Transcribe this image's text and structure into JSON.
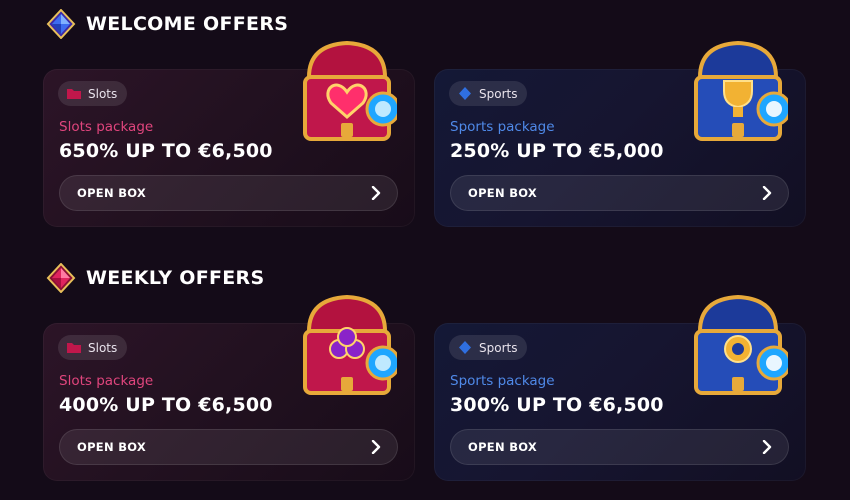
{
  "welcome": {
    "title": "WELCOME OFFERS",
    "cards": [
      {
        "tag": "Slots",
        "package": "Slots package",
        "headline": "650% UP TO €6,500",
        "button": "OPEN BOX"
      },
      {
        "tag": "Sports",
        "package": "Sports package",
        "headline": "250% UP TO €5,000",
        "button": "OPEN BOX"
      }
    ]
  },
  "weekly": {
    "title": "WEEKLY OFFERS",
    "cards": [
      {
        "tag": "Slots",
        "package": "Slots package",
        "headline": "400% UP TO €6,500",
        "button": "OPEN BOX"
      },
      {
        "tag": "Sports",
        "package": "Sports package",
        "headline": "300% UP TO €6,500",
        "button": "OPEN BOX"
      }
    ]
  },
  "icons": {
    "welcome_gem": "blue-diamond-icon",
    "weekly_gem": "red-diamond-icon",
    "slots_tag": "slots-folder-icon",
    "sports_tag": "sports-diamond-icon",
    "button": "chevron-right-icon",
    "slots_chest": "slots-treasure-chest-icon",
    "sports_chest": "sports-treasure-chest-icon"
  },
  "colors": {
    "background": "#140b18",
    "slots_accent": "#e0457d",
    "sports_accent": "#4f89e8"
  }
}
